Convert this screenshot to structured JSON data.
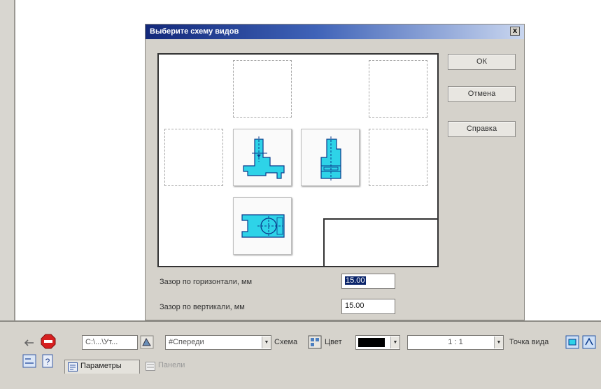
{
  "dialog": {
    "title": "Выберите схему видов",
    "close_label": "x",
    "buttons": {
      "ok": "ОК",
      "cancel": "Отмена",
      "help": "Справка"
    },
    "gap_horizontal": {
      "label": "Зазор по горизонтали, мм",
      "value": "15.00"
    },
    "gap_vertical": {
      "label": "Зазор по вертикали, мм",
      "value": "15.00"
    }
  },
  "toolbar": {
    "path": "C:\\...\\Ут...",
    "view_name": "#Спереди",
    "scheme_label": "Схема",
    "color_label": "Цвет",
    "scale_value": "1 : 1",
    "view_point_label": "Точка вида",
    "tabs": [
      {
        "label": "Параметры"
      },
      {
        "label": "Панели"
      }
    ]
  },
  "colors": {
    "part_fill": "#2ed3e8",
    "titlebar": "#12287a"
  }
}
